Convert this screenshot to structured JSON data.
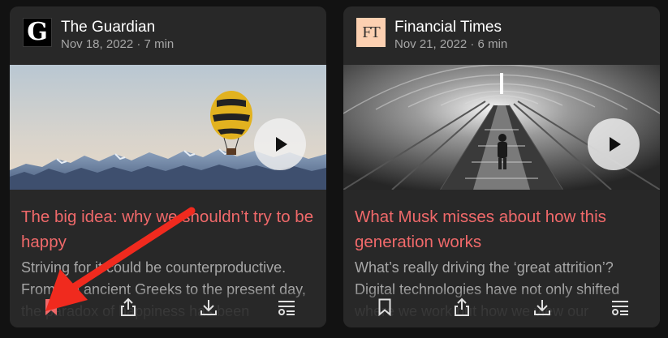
{
  "cards": [
    {
      "publisher": "The Guardian",
      "logo_text": "G",
      "meta": "Nov 18, 2022 · 7 min",
      "title": "The big idea: why we shouldn’t try to be happy",
      "description": "Striving for it could be counterproductive. From the ancient Greeks to the present day, the paradox of happiness has been",
      "image_desc": "hot-air-balloon-over-mountains",
      "bookmarked": true,
      "bookmark_color": "#f0696a"
    },
    {
      "publisher": "Financial Times",
      "logo_text": "FT",
      "meta": "Nov 21, 2022 · 6 min",
      "title": "What Musk misses about how this generation works",
      "description": "What’s really driving the ‘great attrition’? Digital technologies have not only shifted where we work but how we view our",
      "image_desc": "escalators-in-tunnel",
      "bookmarked": false
    }
  ],
  "colors": {
    "accent": "#f0696a",
    "card_bg": "#282828",
    "page_bg": "#121212",
    "annotation_arrow": "#f02a1e"
  },
  "icons": [
    "bookmark-icon",
    "share-icon",
    "download-icon",
    "add-to-queue-icon",
    "play-icon"
  ]
}
